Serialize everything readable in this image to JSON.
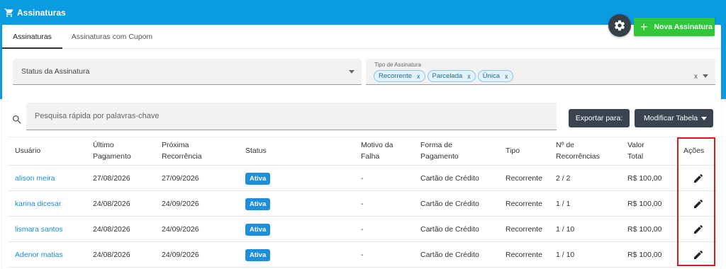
{
  "app": {
    "title": "Assinaturas",
    "cart_icon": "shopping-cart-icon"
  },
  "tabs": [
    {
      "label": "Assinaturas",
      "active": true
    },
    {
      "label": "Assinaturas com Cupom",
      "active": false
    }
  ],
  "actions": {
    "new_label": "Nova Assinatura",
    "settings_icon": "gear-icon"
  },
  "filters": {
    "status_placeholder": "Status da Assinatura",
    "type_label": "Tipo de Assinatura",
    "type_chips": [
      "Recorrente",
      "Parcelada",
      "Única"
    ],
    "chip_remove": "x",
    "clear": "x"
  },
  "search": {
    "placeholder": "Pesquisa rápida por palavras-chave"
  },
  "toolbar": {
    "export_label": "Exportar para:",
    "modify_label": "Modificar Tabela"
  },
  "table": {
    "headers": [
      [
        "Usuário"
      ],
      [
        "Último",
        "Pagamento"
      ],
      [
        "Próxima",
        "Recorrência"
      ],
      [
        "Status"
      ],
      [
        "Motivo da",
        "Falha"
      ],
      [
        "Forma de",
        "Pagamento"
      ],
      [
        "Tipo"
      ],
      [
        "Nº de",
        "Recorrências"
      ],
      [
        "Valor",
        "Total"
      ],
      [
        "Ações"
      ]
    ],
    "rows": [
      {
        "user": "alison meira",
        "last": "27/08/2026",
        "next": "27/09/2026",
        "status": "Ativa",
        "reason": "-",
        "method": "Cartão de Crédito",
        "type": "Recorrente",
        "count": "2 / 2",
        "total": "R$ 100,00"
      },
      {
        "user": "karina dicesar",
        "last": "24/08/2026",
        "next": "24/09/2026",
        "status": "Ativa",
        "reason": "-",
        "method": "Cartão de Crédito",
        "type": "Recorrente",
        "count": "1 / 1",
        "total": "R$ 100,00"
      },
      {
        "user": "lismara santos",
        "last": "24/08/2026",
        "next": "24/09/2026",
        "status": "Ativa",
        "reason": "-",
        "method": "Cartão de Crédito",
        "type": "Recorrente",
        "count": "1 / 10",
        "total": "R$ 100,00"
      },
      {
        "user": "Adenor matias",
        "last": "24/08/2026",
        "next": "24/09/2026",
        "status": "Ativa",
        "reason": "-",
        "method": "Cartão de Crédito",
        "type": "Recorrente",
        "count": "1 / 10",
        "total": "R$ 100,00"
      }
    ]
  },
  "colors": {
    "header_blue": "#0b9be0",
    "new_green": "#2fc83a",
    "badge_blue": "#1f8fdc",
    "dark_btn": "#3a4350",
    "highlight_red": "#e01818"
  }
}
